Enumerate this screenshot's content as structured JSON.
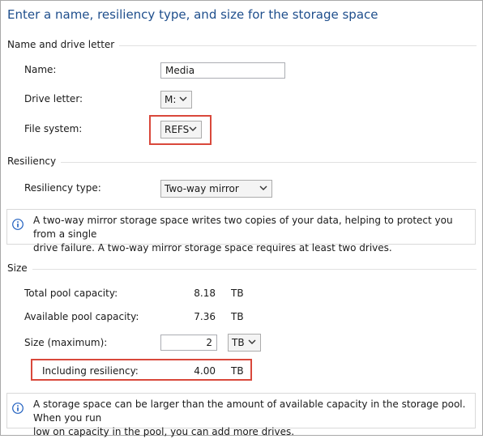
{
  "header": {
    "title": "Enter a name, resiliency type, and size for the storage space"
  },
  "name_section": {
    "title": "Name and drive letter",
    "name_label": "Name:",
    "name_value": "Media",
    "drive_label": "Drive letter:",
    "drive_value": "M:",
    "fs_label": "File system:",
    "fs_value": "REFS"
  },
  "resiliency_section": {
    "title": "Resiliency",
    "type_label": "Resiliency type:",
    "type_value": "Two-way mirror",
    "info_line1": "A two-way mirror storage space writes two copies of your data, helping to protect you from a single",
    "info_line2": "drive failure. A two-way mirror storage space requires at least two drives."
  },
  "size_section": {
    "title": "Size",
    "total_label": "Total pool capacity:",
    "total_value": "8.18",
    "total_unit": "TB",
    "available_label": "Available pool capacity:",
    "available_value": "7.36",
    "available_unit": "TB",
    "size_label": "Size (maximum):",
    "size_value": "2",
    "size_unit": "TB",
    "including_label": "Including resiliency:",
    "including_value": "4.00",
    "including_unit": "TB",
    "info_line1": "A storage space can be larger than the amount of available capacity in the storage pool. When you run",
    "info_line2": "low on capacity in the pool, you can add more drives."
  },
  "colors": {
    "heading": "#1e4e8c",
    "highlight": "#d9483b",
    "info_icon": "#1f5fbf"
  },
  "icons": {
    "info": "info-icon",
    "dropdown": "chevron-down-icon"
  }
}
